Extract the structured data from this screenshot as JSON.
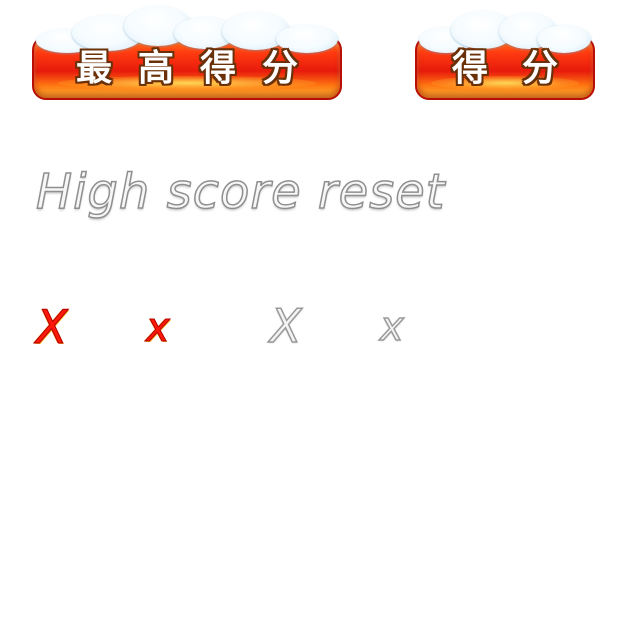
{
  "banners": {
    "high_score": {
      "label": "最高得分"
    },
    "score": {
      "label": "得分"
    }
  },
  "reset_caption": "High score reset",
  "close_glyphs": {
    "large_red": "X",
    "small_red": "x",
    "large_silver": "X",
    "small_silver": "x"
  },
  "colors": {
    "background": "#ffffff",
    "banner_red": "#e81a0c",
    "banner_orange": "#ff7a12",
    "banner_gold": "#ffc23a",
    "banner_outline": "#b80e06",
    "banner_text": "#ffffff",
    "banner_text_outline": "#6a3008",
    "snow": "#f4fbff",
    "glyph_red": "#ff1a08",
    "silver_fill": "#f4f4f4",
    "silver_outline": "#9a9a9a"
  },
  "icons": [
    "snow-cap-icon",
    "close-icon"
  ]
}
